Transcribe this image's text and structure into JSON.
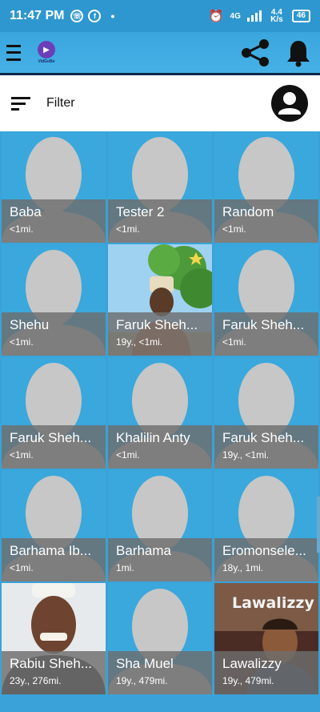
{
  "status_bar": {
    "time": "11:47 PM",
    "left_icons": [
      "whatsapp-icon",
      "facebook-icon"
    ],
    "network": "4G",
    "speed": "4.4 K/s",
    "battery": "46"
  },
  "app_bar": {
    "logo_text": "VidGoBe",
    "actions": [
      "share-icon",
      "bell-icon"
    ]
  },
  "filter": {
    "label": "Filter"
  },
  "profiles": [
    {
      "name": "Baba",
      "distance": "<1mi.",
      "photo": "silhouette"
    },
    {
      "name": "Tester 2",
      "distance": "<1mi.",
      "photo": "silhouette"
    },
    {
      "name": "Random",
      "distance": "<1mi.",
      "photo": "silhouette"
    },
    {
      "name": "Shehu",
      "distance": "<1mi.",
      "photo": "silhouette"
    },
    {
      "name": "Faruk Sheh...",
      "distance": "19y., <1mi.",
      "photo": "outdoor"
    },
    {
      "name": "Faruk Sheh...",
      "distance": "<1mi.",
      "photo": "silhouette"
    },
    {
      "name": "Faruk Sheh...",
      "distance": "<1mi.",
      "photo": "silhouette"
    },
    {
      "name": "Khalilin Anty",
      "distance": "<1mi.",
      "photo": "silhouette"
    },
    {
      "name": "Faruk Sheh...",
      "distance": "19y., <1mi.",
      "photo": "silhouette"
    },
    {
      "name": "Barhama Ib...",
      "distance": "<1mi.",
      "photo": "silhouette"
    },
    {
      "name": "Barhama",
      "distance": "1mi.",
      "photo": "silhouette"
    },
    {
      "name": "Eromonsele...",
      "distance": "18y., 1mi.",
      "photo": "silhouette"
    },
    {
      "name": "Rabiu Sheh...",
      "distance": "23y., 276mi.",
      "photo": "portrait"
    },
    {
      "name": "Sha Muel",
      "distance": "19y., 479mi.",
      "photo": "silhouette"
    },
    {
      "name": "Lawalizzy",
      "distance": "19y., 479mi.",
      "photo": "cartoon",
      "overlay_text": "Lawalizzy"
    }
  ]
}
